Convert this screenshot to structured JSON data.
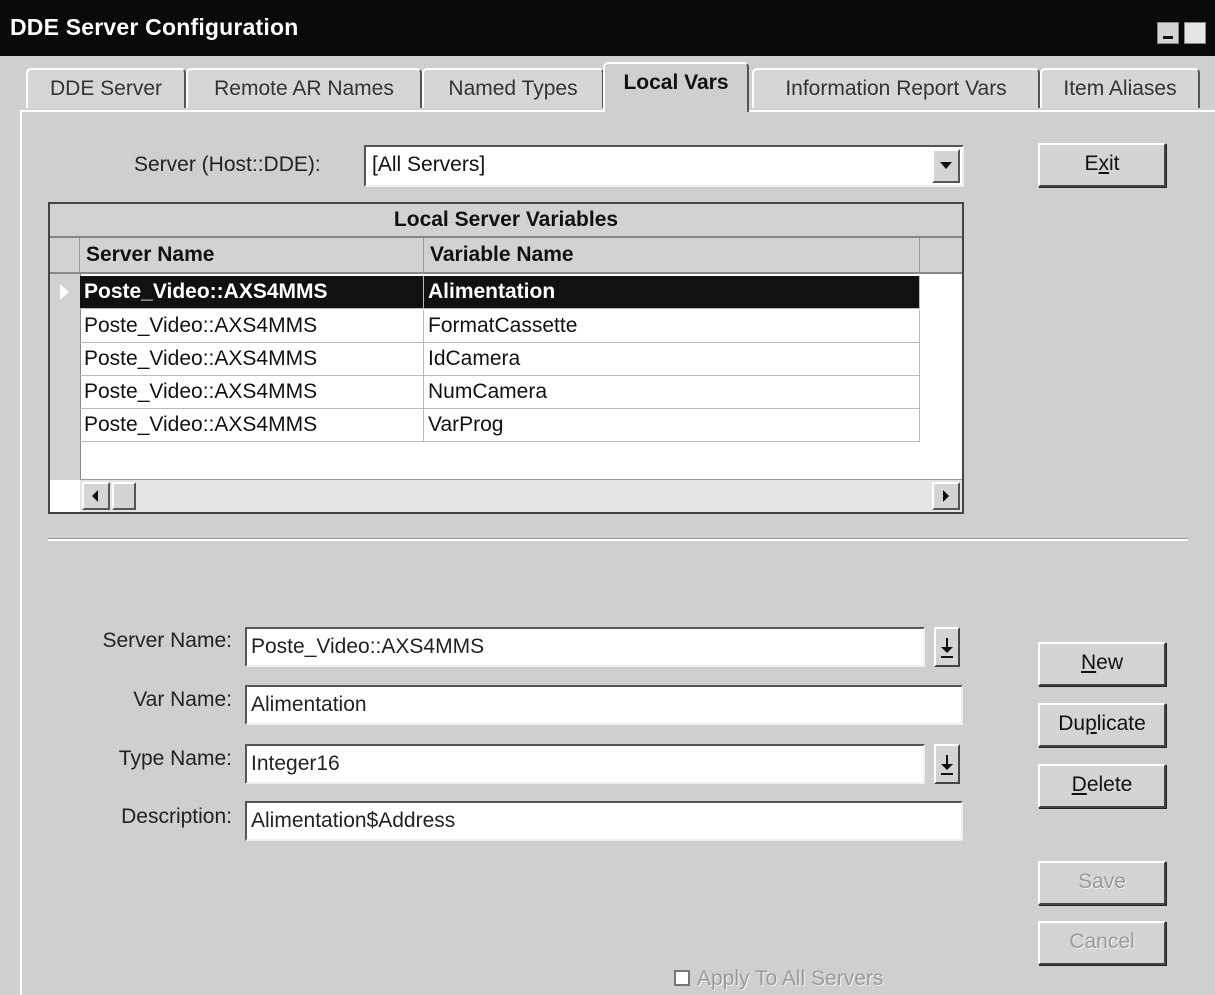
{
  "window": {
    "title": "DDE Server Configuration"
  },
  "tabs": [
    {
      "label": "DDE Server"
    },
    {
      "label": "Remote AR Names"
    },
    {
      "label": "Named Types"
    },
    {
      "label": "Local Vars"
    },
    {
      "label": "Information Report Vars"
    },
    {
      "label": "Item Aliases"
    }
  ],
  "active_tab": "Local Vars",
  "server_filter": {
    "label": "Server (Host::DDE):",
    "value": "[All Servers]"
  },
  "buttons": {
    "exit": {
      "pre": "E",
      "u": "x",
      "post": "it"
    },
    "new": {
      "pre": "",
      "u": "N",
      "post": "ew"
    },
    "duplicate": {
      "pre": "Du",
      "u": "p",
      "post": "licate"
    },
    "delete": {
      "pre": "",
      "u": "D",
      "post": "elete"
    },
    "save": "Save",
    "cancel": "Cancel"
  },
  "grid": {
    "caption": "Local Server Variables",
    "columns": [
      "Server Name",
      "Variable Name"
    ],
    "rows": [
      {
        "server": "Poste_Video::AXS4MMS",
        "variable": "Alimentation",
        "selected": true
      },
      {
        "server": "Poste_Video::AXS4MMS",
        "variable": "FormatCassette"
      },
      {
        "server": "Poste_Video::AXS4MMS",
        "variable": "IdCamera"
      },
      {
        "server": "Poste_Video::AXS4MMS",
        "variable": "NumCamera"
      },
      {
        "server": "Poste_Video::AXS4MMS",
        "variable": "VarProg"
      }
    ]
  },
  "form": {
    "server_name": {
      "label": "Server Name:",
      "value": "Poste_Video::AXS4MMS"
    },
    "var_name": {
      "label": "Var Name:",
      "value": "Alimentation"
    },
    "type_name": {
      "label": "Type Name:",
      "value": "Integer16"
    },
    "description": {
      "label": "Description:",
      "value": "Alimentation$Address"
    }
  },
  "apply_all": {
    "label": "Apply To All  Servers",
    "checked": false
  }
}
